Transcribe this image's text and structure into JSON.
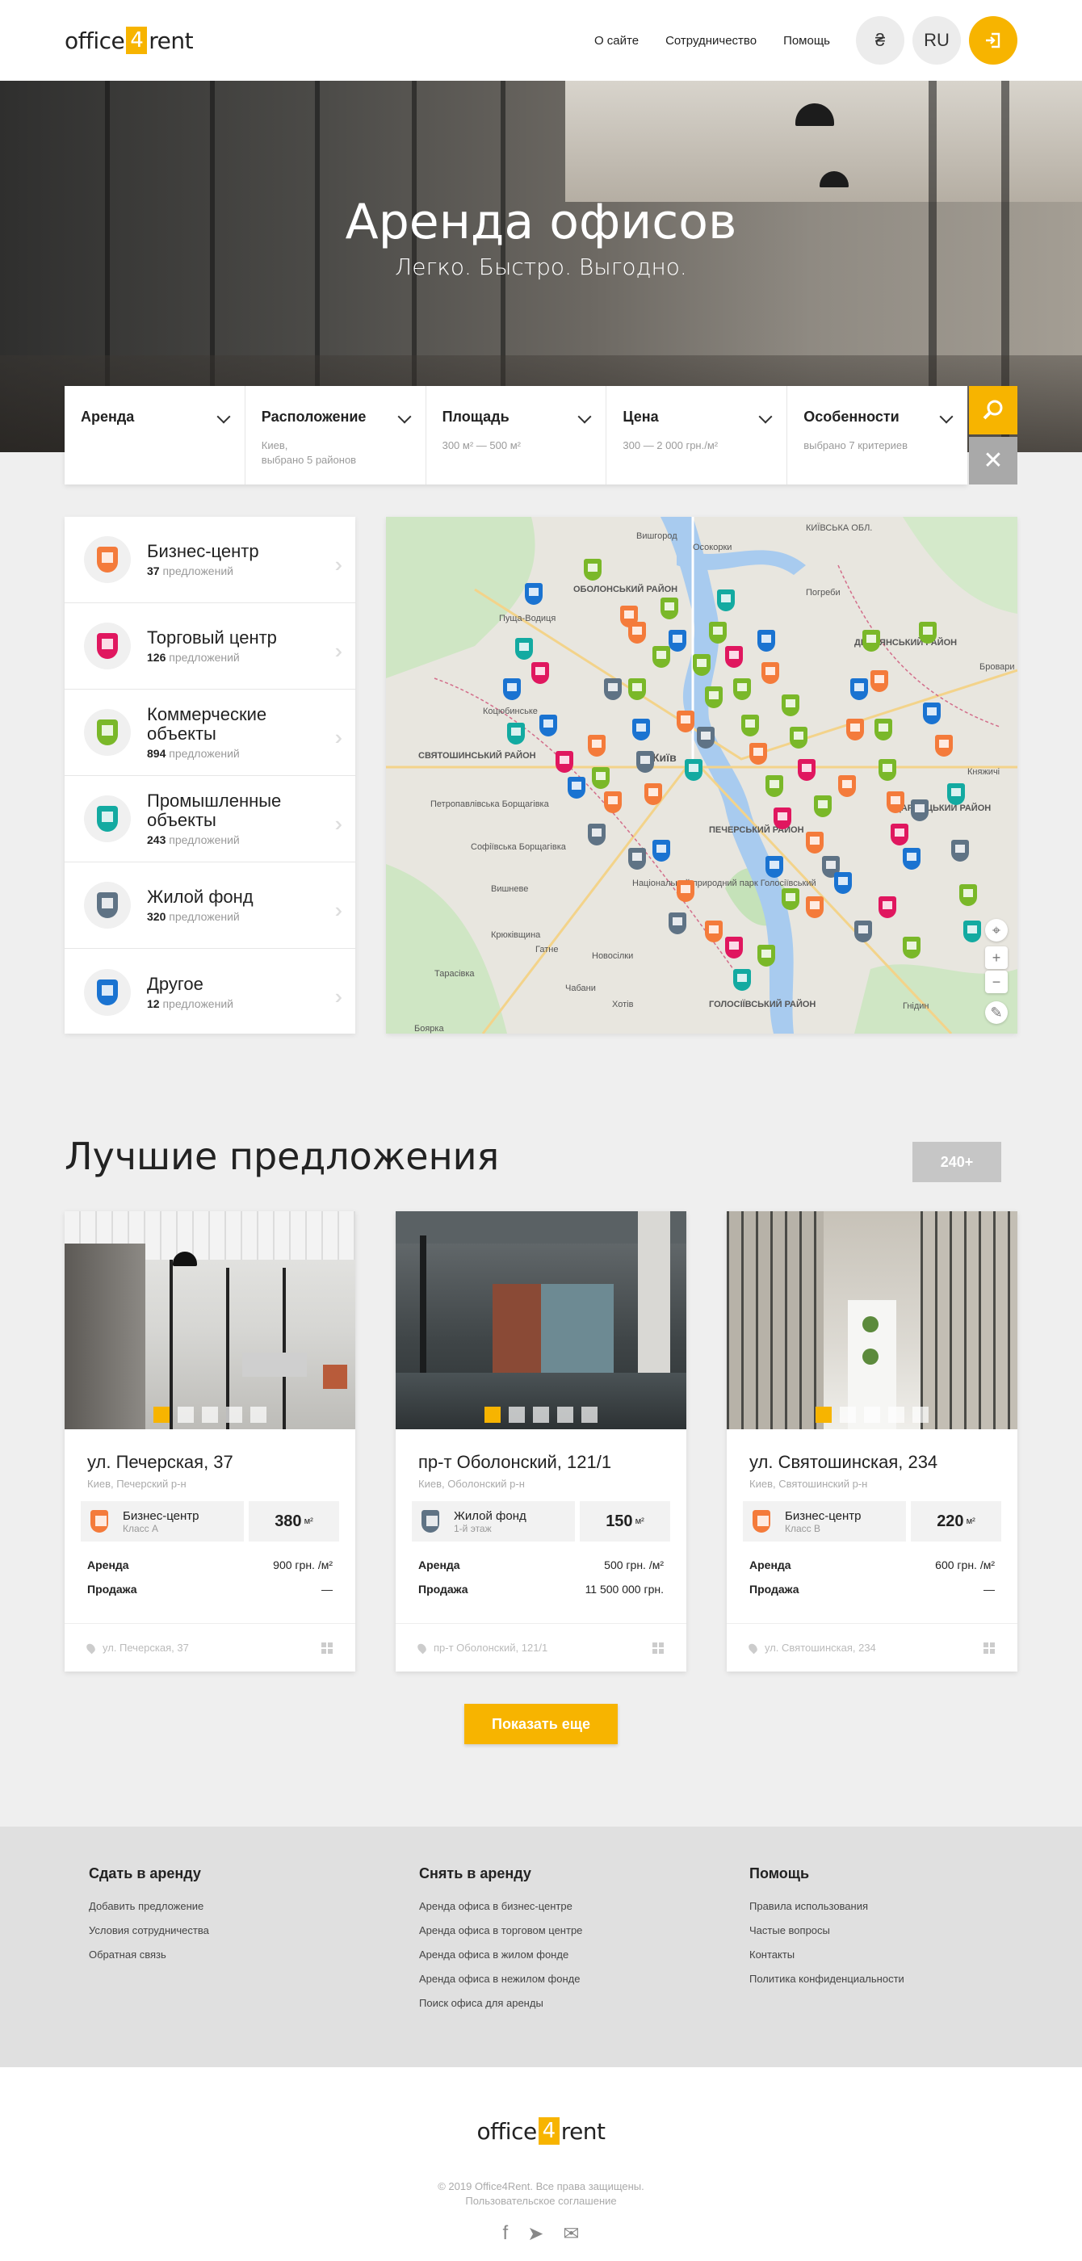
{
  "header": {
    "logo_left": "office",
    "logo_four": "4",
    "logo_right": "rent",
    "nav": [
      "О сайте",
      "Сотрудничество",
      "Помощь"
    ],
    "currency": "₴",
    "lang": "RU"
  },
  "hero": {
    "title": "Аренда офисов",
    "subtitle": "Легко. Быстро. Выгодно."
  },
  "filter": [
    {
      "label": "Аренда",
      "sub": ""
    },
    {
      "label": "Расположение",
      "sub": "Киев,\nвыбрано 5 районов"
    },
    {
      "label": "Площадь",
      "sub": "300 м² — 500 м²"
    },
    {
      "label": "Цена",
      "sub": "300 — 2 000 грн./м²"
    },
    {
      "label": "Особенности",
      "sub": "выбрано 7 критериев"
    }
  ],
  "categories": [
    {
      "name": "Бизнес-центр",
      "count": "37",
      "suffix": "предложений",
      "color": "#f47b3b"
    },
    {
      "name": "Торговый центр",
      "count": "126",
      "suffix": "предложений",
      "color": "#e0175f"
    },
    {
      "name": "Коммерческие объекты",
      "count": "894",
      "suffix": "предложений",
      "color": "#7ab829"
    },
    {
      "name": "Промышленные объекты",
      "count": "243",
      "suffix": "предложений",
      "color": "#13aaa1"
    },
    {
      "name": "Жилой фонд",
      "count": "320",
      "suffix": "предложений",
      "color": "#5f7385"
    },
    {
      "name": "Другое",
      "count": "12",
      "suffix": "предложений",
      "color": "#1a73d1"
    }
  ],
  "map_labels": [
    "КИЇВСЬКА ОБЛ.",
    "Вишгород",
    "ОБОЛОНСЬКИЙ РАЙОН",
    "Осокорки",
    "Погреби",
    "Пуща-Водиця",
    "ДЕСНЯНСЬКИЙ РАЙОН",
    "ДАРНИЦЬКИЙ РАЙОН",
    "Коцюбинське",
    "СВЯТОШИНСЬКИЙ РАЙОН",
    "Київ",
    "Бровари",
    "Петропавлівська Борщагівка",
    "Софіївська Борщагівка",
    "Вишневе",
    "ПЕЧЕРСЬКИЙ РАЙОН",
    "Національний природний парк Голосіївський",
    "Крюківщина",
    "Гатне",
    "Новосілки",
    "Чабани",
    "Хотів",
    "ГОЛОСІЇВСЬКИЙ РАЙОН",
    "Гнідин",
    "Боярка",
    "Тарасівка",
    "Княжичі"
  ],
  "best": {
    "title": "Лучшие предложения",
    "count": "240+",
    "more": "Показать еще"
  },
  "cards": [
    {
      "addr": "ул. Печерская, 37",
      "district": "Киев, Печерский р-н",
      "type": "Бизнес-центр",
      "class": "Класс А",
      "area": "380",
      "unit": "м²",
      "rent_label": "Аренда",
      "rent": "900 грн. /м²",
      "sale_label": "Продажа",
      "sale": "—",
      "foot": "ул. Печерская, 37",
      "color": "#f47b3b"
    },
    {
      "addr": "пр-т Оболонский, 121/1",
      "district": "Киев, Оболонский р-н",
      "type": "Жилой фонд",
      "class": "1-й этаж",
      "area": "150",
      "unit": "м²",
      "rent_label": "Аренда",
      "rent": "500 грн. /м²",
      "sale_label": "Продажа",
      "sale": "11 500 000 грн.",
      "foot": "пр-т Оболонский, 121/1",
      "color": "#5f7385"
    },
    {
      "addr": "ул. Святошинская, 234",
      "district": "Киев, Святошинский р-н",
      "type": "Бизнес-центр",
      "class": "Класс В",
      "area": "220",
      "unit": "м²",
      "rent_label": "Аренда",
      "rent": "600 грн. /м²",
      "sale_label": "Продажа",
      "sale": "—",
      "foot": "ул. Святошинская, 234",
      "color": "#f47b3b"
    }
  ],
  "footer": {
    "cols": [
      {
        "title": "Сдать в аренду",
        "links": [
          "Добавить предложение",
          "Условия сотрудничества",
          "Обратная связь"
        ]
      },
      {
        "title": "Снять в аренду",
        "links": [
          "Аренда офиса в бизнес-центре",
          "Аренда офиса в торговом центре",
          "Аренда офиса в жилом фонде",
          "Аренда офиса в нежилом фонде",
          "Поиск офиса для аренды"
        ]
      },
      {
        "title": "Помощь",
        "links": [
          "Правила использования",
          "Частые вопросы",
          "Контакты",
          "Политика конфиденциальности"
        ]
      }
    ],
    "copyright": "© 2019 Office4Rent. Все права защищены.",
    "agreement": "Пользовательское соглашение"
  }
}
